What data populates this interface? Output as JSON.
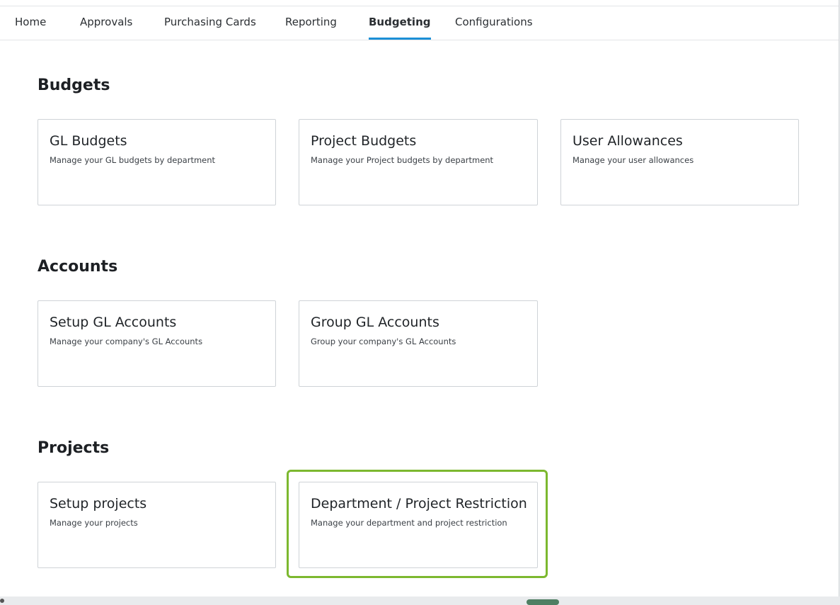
{
  "nav": {
    "items": [
      {
        "label": "Home"
      },
      {
        "label": "Approvals"
      },
      {
        "label": "Purchasing Cards"
      },
      {
        "label": "Reporting"
      },
      {
        "label": "Budgeting"
      },
      {
        "label": "Configurations"
      }
    ],
    "active": "Budgeting",
    "accent_color": "#1c8fd6"
  },
  "sections": [
    {
      "title": "Budgets",
      "cards": [
        {
          "title": "GL Budgets",
          "description": "Manage your GL budgets by department"
        },
        {
          "title": "Project Budgets",
          "description": "Manage your Project budgets by department"
        },
        {
          "title": "User Allowances",
          "description": "Manage your user allowances"
        }
      ]
    },
    {
      "title": "Accounts",
      "cards": [
        {
          "title": "Setup GL Accounts",
          "description": "Manage your company's GL Accounts"
        },
        {
          "title": "Group GL Accounts",
          "description": "Group your company's GL Accounts"
        }
      ]
    },
    {
      "title": "Projects",
      "cards": [
        {
          "title": "Setup projects",
          "description": "Manage your projects"
        },
        {
          "title": "Department / Project Restriction",
          "description": "Manage your department and project restriction"
        }
      ]
    }
  ],
  "highlight_color": "#7cb82f"
}
